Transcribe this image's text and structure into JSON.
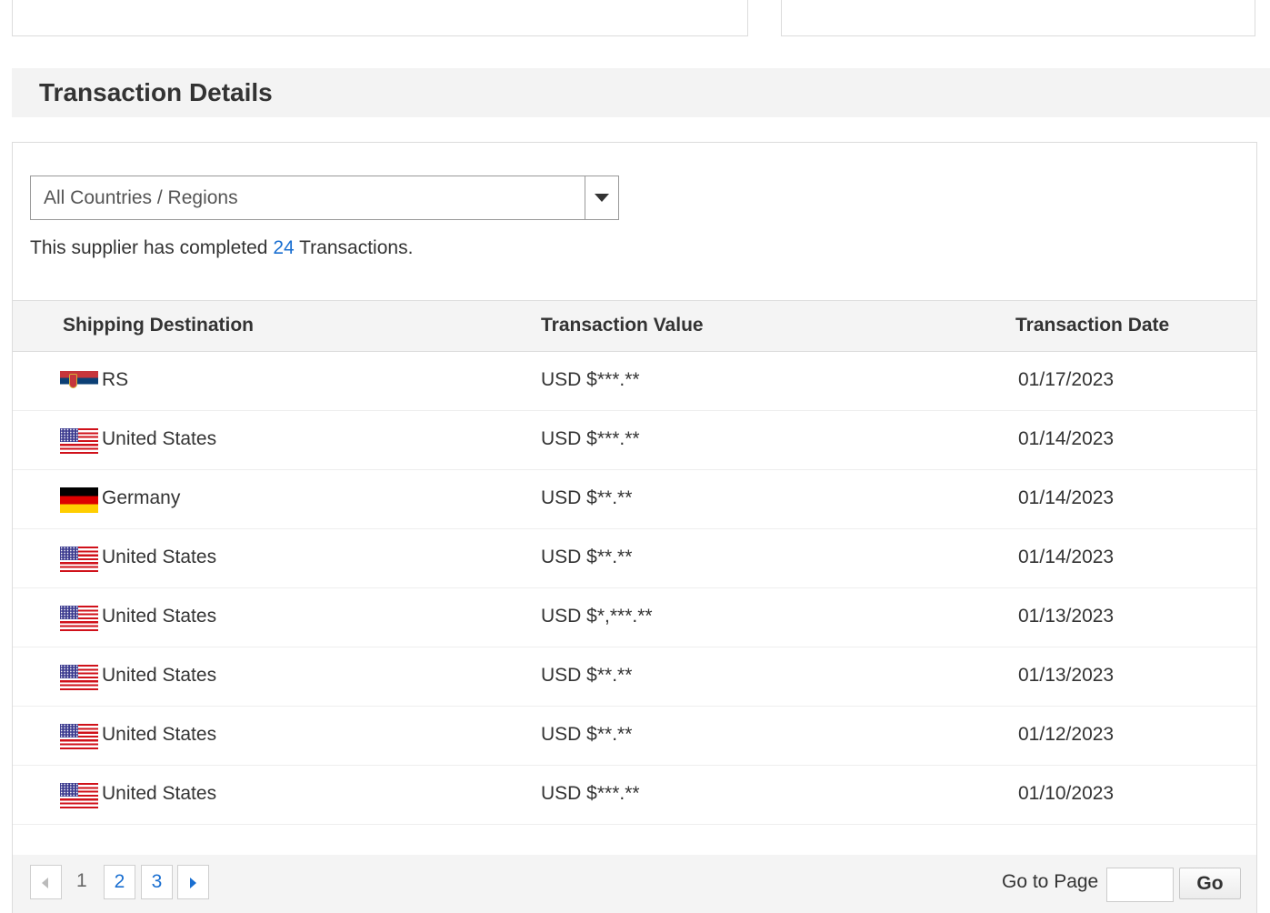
{
  "section": {
    "title": "Transaction Details"
  },
  "filter": {
    "selected": "All Countries / Regions"
  },
  "summary": {
    "prefix": "This supplier has completed ",
    "count": "24",
    "suffix": " Transactions."
  },
  "table": {
    "headers": [
      "Shipping Destination",
      "Transaction Value",
      "Transaction Date"
    ],
    "rows": [
      {
        "flag": "serbia-flag",
        "destination": "RS",
        "value": "USD $***.**",
        "date": "01/17/2023"
      },
      {
        "flag": "us-flag",
        "destination": "United States",
        "value": "USD $***.**",
        "date": "01/14/2023"
      },
      {
        "flag": "germany-flag",
        "destination": "Germany",
        "value": "USD $**.**",
        "date": "01/14/2023"
      },
      {
        "flag": "us-flag",
        "destination": "United States",
        "value": "USD $**.**",
        "date": "01/14/2023"
      },
      {
        "flag": "us-flag",
        "destination": "United States",
        "value": "USD $*,***.**",
        "date": "01/13/2023"
      },
      {
        "flag": "us-flag",
        "destination": "United States",
        "value": "USD $**.**",
        "date": "01/13/2023"
      },
      {
        "flag": "us-flag",
        "destination": "United States",
        "value": "USD $**.**",
        "date": "01/12/2023"
      },
      {
        "flag": "us-flag",
        "destination": "United States",
        "value": "USD $***.**",
        "date": "01/10/2023"
      }
    ]
  },
  "pagination": {
    "current": "1",
    "pages": [
      "2",
      "3"
    ],
    "goto_label": "Go to Page",
    "goto_value": "",
    "go_button": "Go"
  },
  "colors": {
    "link": "#1a6fd1",
    "header_bg": "#f3f3f3"
  }
}
